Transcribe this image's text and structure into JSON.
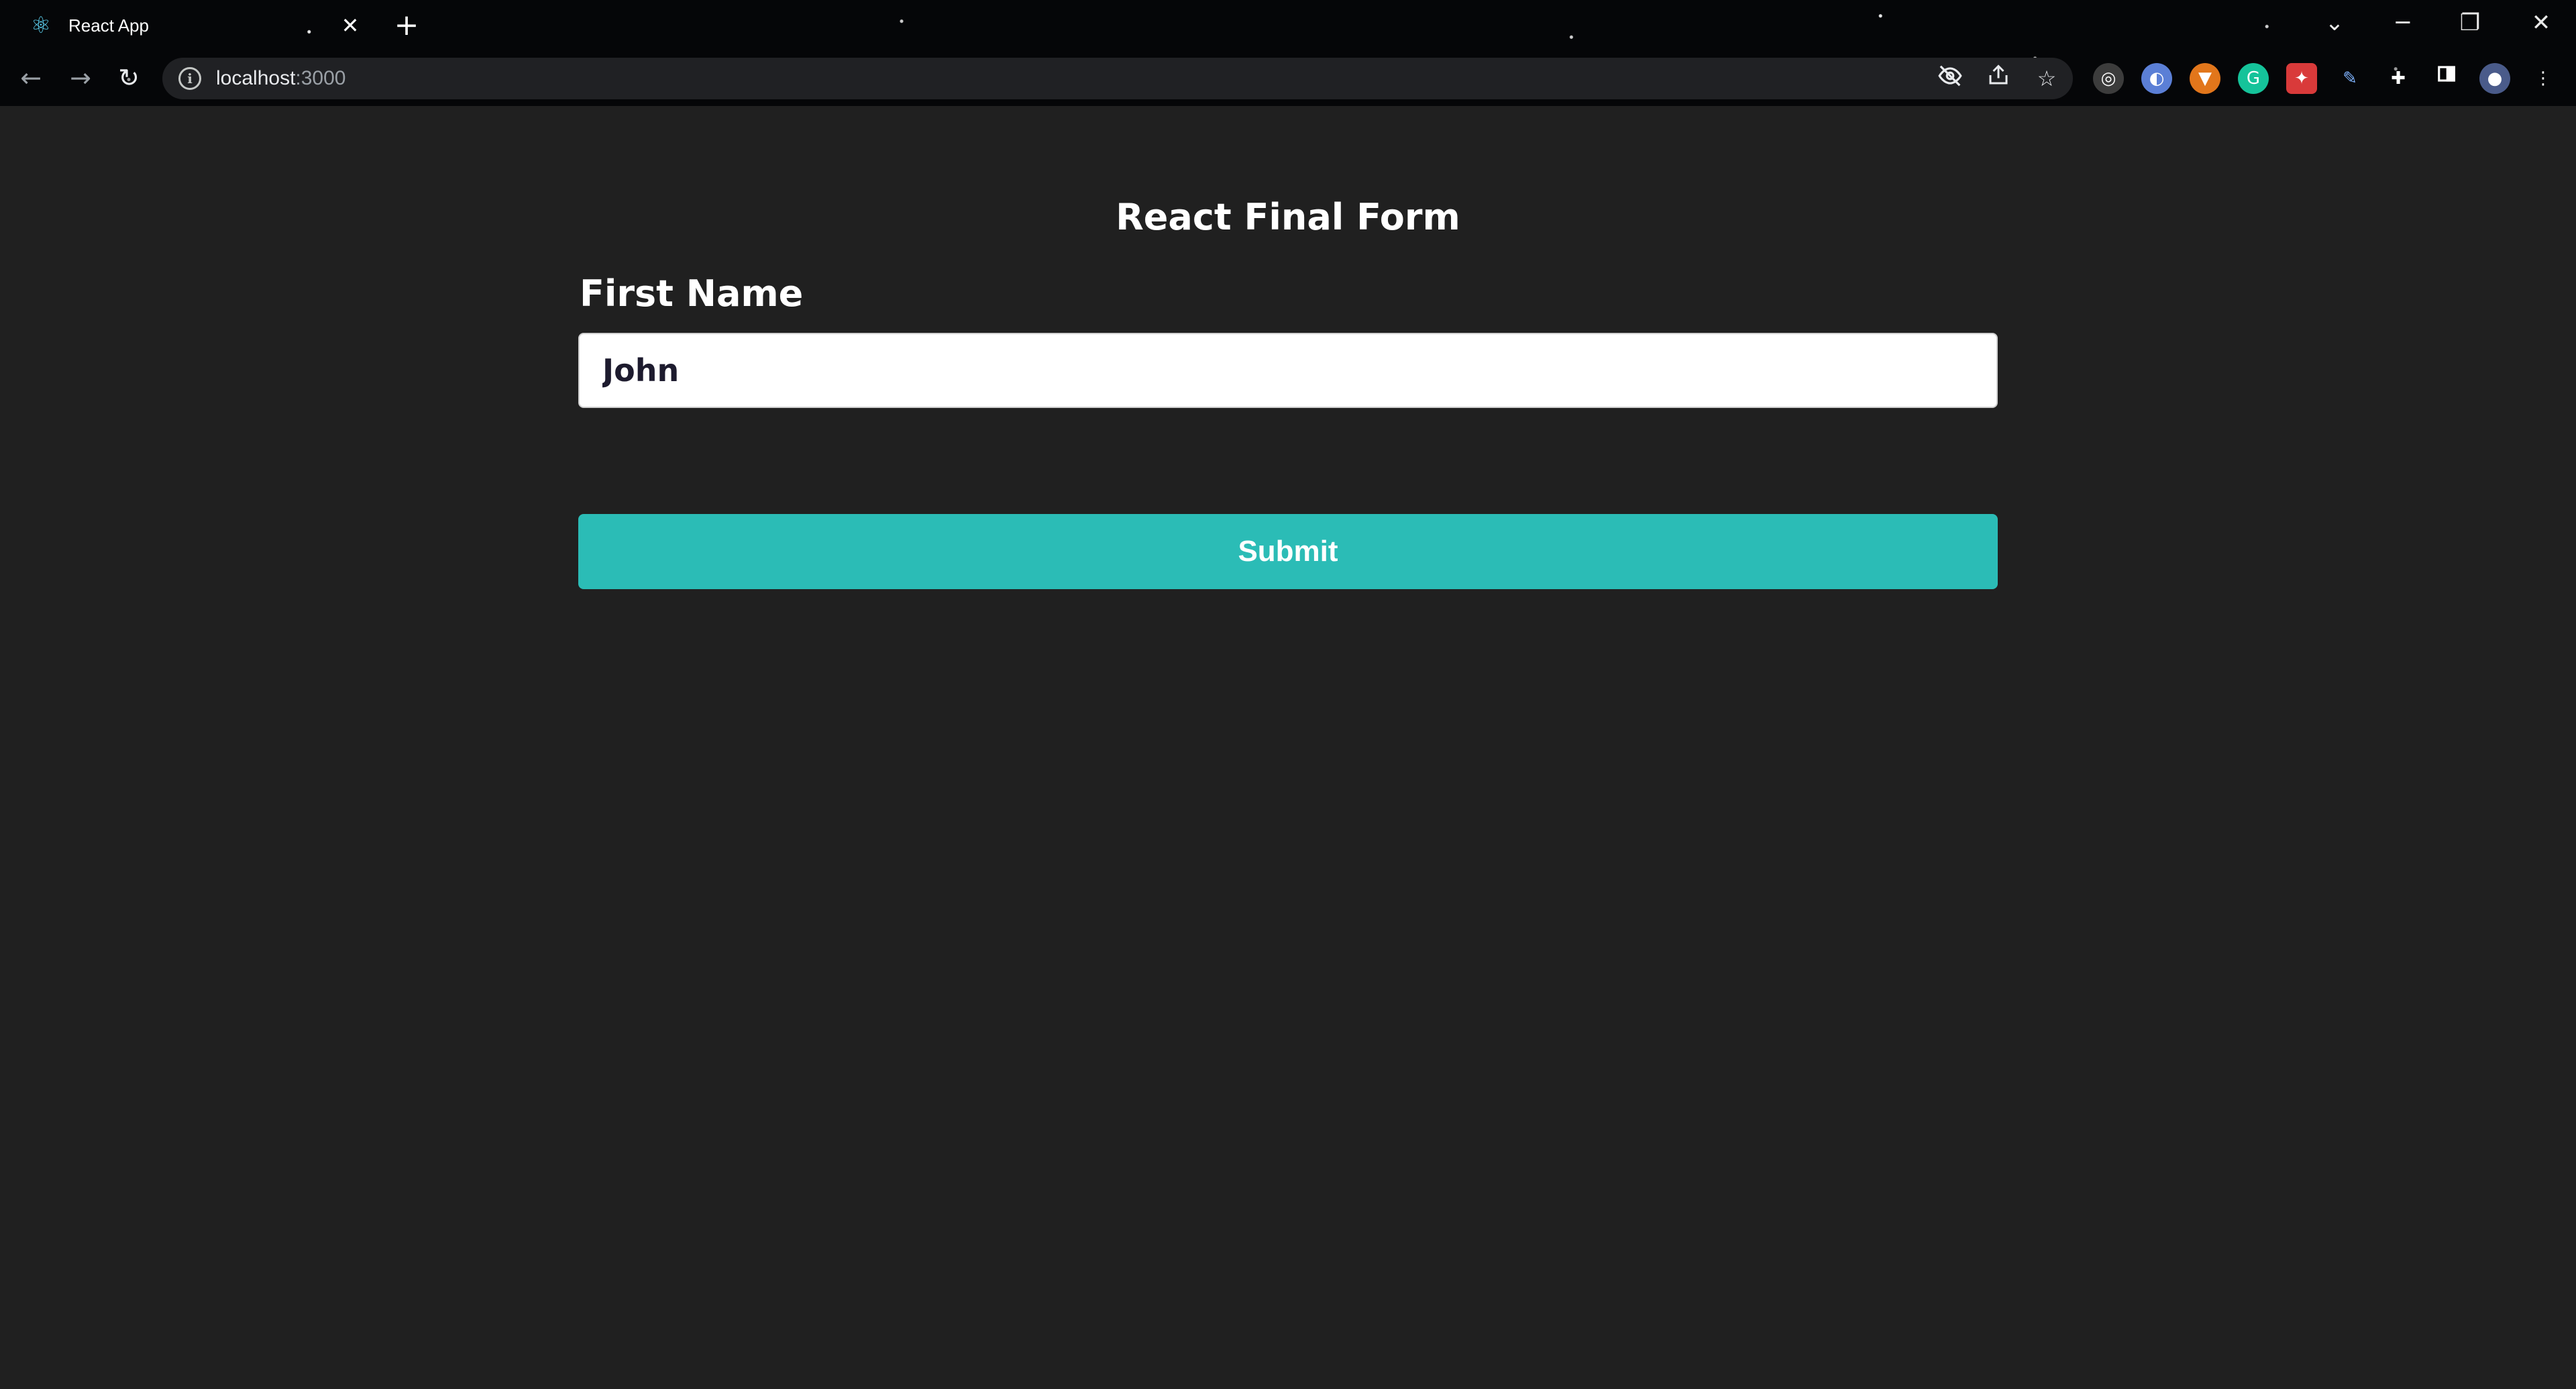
{
  "browser": {
    "tab": {
      "title": "React App",
      "favicon": "react-logo-icon",
      "close_glyph": "✕"
    },
    "new_tab_glyph": "+",
    "window_controls": {
      "tab_search_glyph": "⌄",
      "minimize_glyph": "─",
      "restore_glyph": "❐",
      "close_glyph": "✕"
    },
    "toolbar": {
      "back_glyph": "←",
      "forward_glyph": "→",
      "reload_glyph": "↻",
      "address": {
        "host": "localhost",
        "port": ":3000"
      },
      "omnibox_icons": [
        "eye-off-icon",
        "share-icon",
        "bookmark-star-icon"
      ],
      "extensions": [
        {
          "name": "target-extension-icon",
          "color": "#3c3c3c"
        },
        {
          "name": "wallet-extension-icon",
          "color": "#5b7fd6"
        },
        {
          "name": "metamask-fox-icon",
          "color": "#e2761b"
        },
        {
          "name": "grammarly-icon",
          "color": "#15c39a"
        },
        {
          "name": "red-extension-icon",
          "color": "#d93a3a"
        },
        {
          "name": "pen-extension-icon",
          "color": "#2a2a2a"
        },
        {
          "name": "puzzle-extensions-icon",
          "color": "#202124"
        },
        {
          "name": "side-panel-icon",
          "color": "#202124"
        },
        {
          "name": "profile-avatar",
          "color": "#4a5b8a"
        },
        {
          "name": "more-menu-icon",
          "color": "#202124"
        }
      ]
    }
  },
  "form": {
    "title": "React Final Form",
    "first_name": {
      "label": "First Name",
      "value": "John"
    },
    "submit_label": "Submit"
  },
  "colors": {
    "page_background": "#202020",
    "submit_button": "#2bbcb6",
    "input_background": "#ffffff",
    "input_text": "#1d1b2e"
  }
}
